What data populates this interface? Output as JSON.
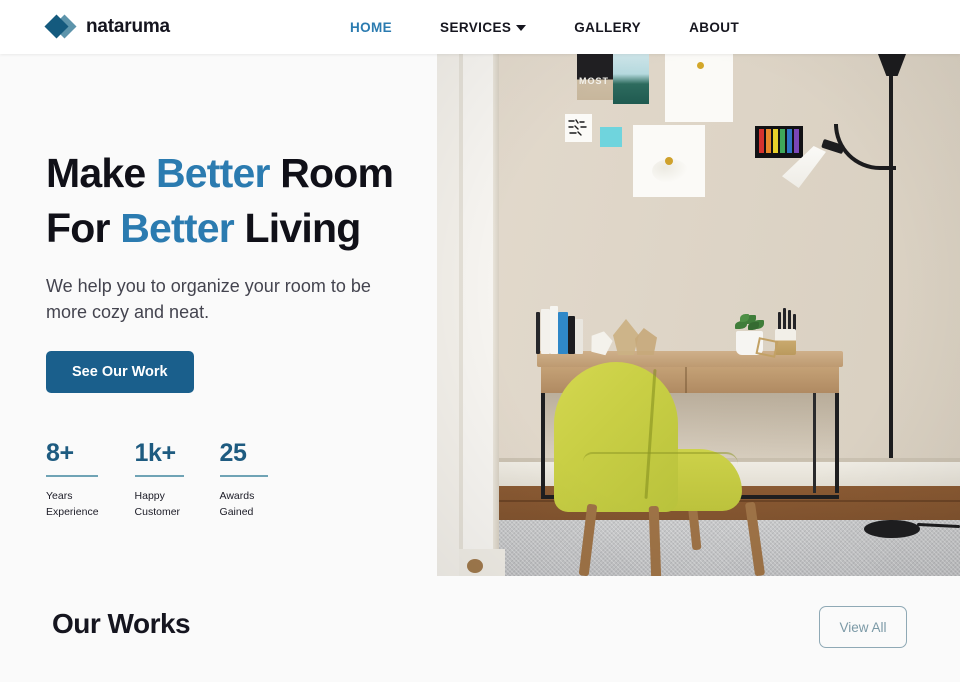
{
  "header": {
    "brand": {
      "name": "nataruma",
      "icon": "diamond-logo-icon"
    },
    "nav": [
      {
        "label": "HOME",
        "active": true,
        "dropdown": false
      },
      {
        "label": "SERVICES",
        "active": false,
        "dropdown": true
      },
      {
        "label": "GALLERY",
        "active": false,
        "dropdown": false
      },
      {
        "label": "ABOUT",
        "active": false,
        "dropdown": false
      }
    ]
  },
  "hero": {
    "title_line1_part1": "Make ",
    "title_line1_accent": "Better",
    "title_line1_part2": " Room",
    "title_line2_part1": "For ",
    "title_line2_accent": "Better",
    "title_line2_part2": " Living",
    "subtitle": "We help you to organize your room to be more cozy and neat.",
    "cta_label": "See Our Work",
    "stats": [
      {
        "value": "8+",
        "label": "Years\nExperience"
      },
      {
        "value": "1k+",
        "label": "Happy\nCustomer"
      },
      {
        "value": "25",
        "label": "Awards\nGained"
      }
    ],
    "photo_alt": "Home office with wooden desk, yellow-green chair, floor lamp and framed wall art"
  },
  "works": {
    "title": "Our Works",
    "view_all_label": "View All"
  },
  "colors": {
    "accent_blue": "#2b7bb0",
    "button_blue": "#1a5f8c",
    "stat_blue": "#1e5b80",
    "stat_rule": "#6fa3b5",
    "outline_button": "#8fa9b5",
    "page_bg": "#fafafa",
    "header_bg": "#ffffff",
    "text_dark": "#15151f",
    "text_muted": "#44444f"
  }
}
